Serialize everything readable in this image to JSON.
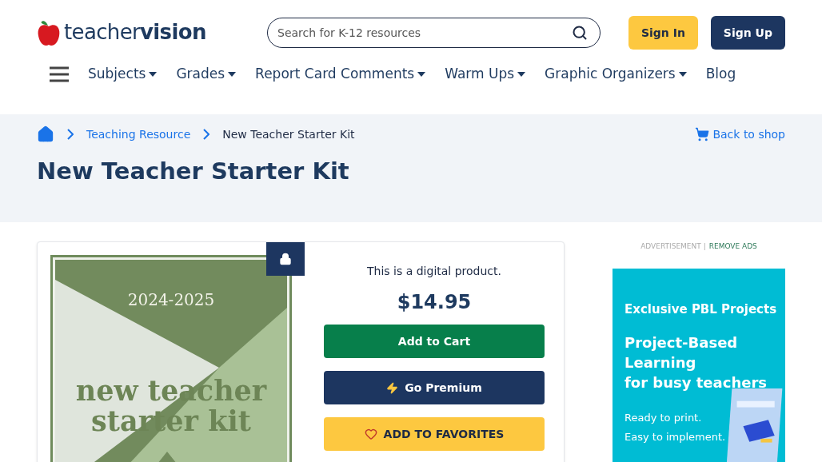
{
  "logo": {
    "light": "teacher",
    "bold": "vision"
  },
  "search": {
    "placeholder": "Search for K-12 resources"
  },
  "auth_buttons": [
    {
      "label": "Sign In",
      "kind": "secondary"
    },
    {
      "label": "Sign Up",
      "kind": "primary"
    }
  ],
  "nav": [
    {
      "label": "Subjects",
      "dropdown": true
    },
    {
      "label": "Grades",
      "dropdown": true
    },
    {
      "label": "Report Card Comments",
      "dropdown": true
    },
    {
      "label": "Warm Ups",
      "dropdown": true
    },
    {
      "label": "Graphic Organizers",
      "dropdown": true
    },
    {
      "label": "Blog",
      "dropdown": false
    }
  ],
  "breadcrumbs": [
    "Teaching Resource",
    "New Teacher Starter Kit"
  ],
  "back_link": "Back to shop",
  "page_title": "New Teacher Starter Kit",
  "product": {
    "cover": {
      "year": "2024-2025",
      "title_line1": "new teacher",
      "title_line2": "starter kit"
    },
    "locked": true,
    "note": "This is a digital product.",
    "price": "$14.95",
    "actions": [
      {
        "label": "Add to Cart",
        "kind": "cart"
      },
      {
        "label": "Go Premium",
        "kind": "premium"
      },
      {
        "label": "ADD TO FAVORITES",
        "kind": "favorite"
      }
    ]
  },
  "ad": {
    "label": "ADVERTISEMENT",
    "separator": "|",
    "remove": "REMOVE ADS",
    "eyebrow": "Exclusive PBL Projects",
    "headline": [
      "Project-Based",
      "Learning",
      "for busy teachers"
    ],
    "lines": [
      "Ready to print.",
      "Easy to implement."
    ]
  }
}
